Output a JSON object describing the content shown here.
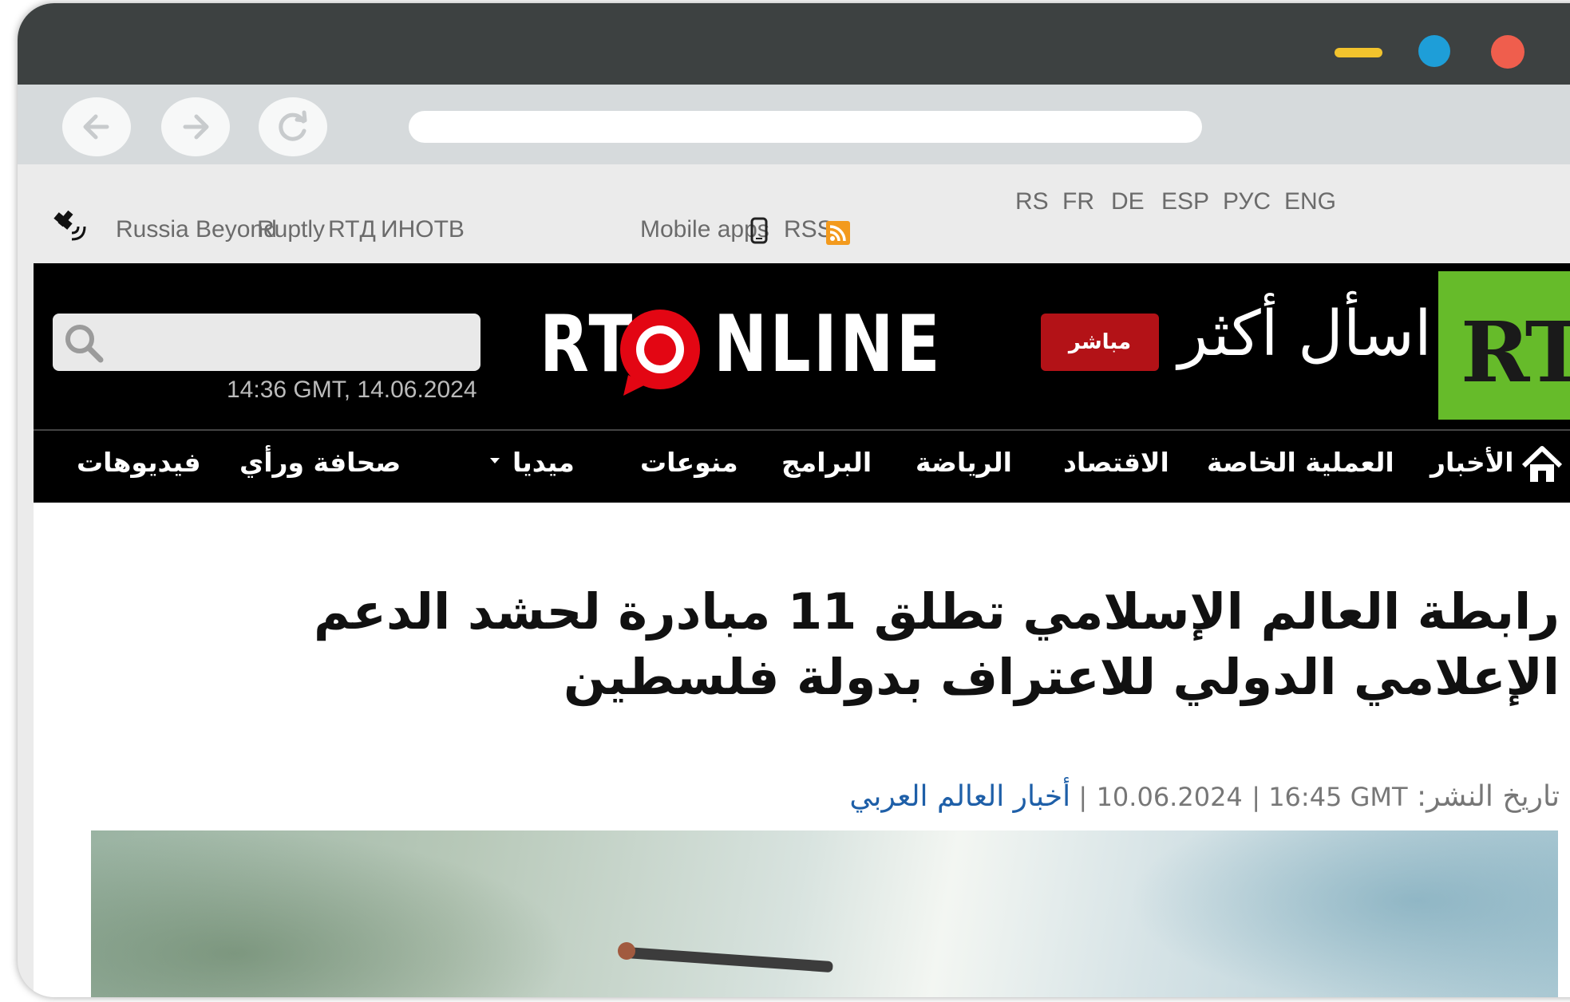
{
  "browser": {
    "back_icon": "arrow-left-icon",
    "forward_icon": "arrow-right-icon",
    "reload_icon": "reload-icon"
  },
  "topbar": {
    "links": [
      "Russia Beyond",
      "Ruptly",
      "RTД",
      "ИНОТВ"
    ],
    "mobile_apps": "Mobile apps",
    "rss": "RSS",
    "languages": [
      "RS",
      "FR",
      "DE",
      "ESP",
      "РУС",
      "ENG"
    ]
  },
  "header": {
    "search_placeholder": "",
    "datetime": "14:36 GMT, 14.06.2024",
    "logo_left": "RT",
    "logo_right": "NLINE",
    "live_label": "مباشر",
    "slogan": "اسأل أكثر",
    "brand": "RT"
  },
  "menu": {
    "items": [
      "الأخبار",
      "العملية الخاصة",
      "الاقتصاد",
      "الرياضة",
      "البرامج",
      "منوعات",
      "ميديا",
      "صحافة ورأي",
      "فيديوهات"
    ]
  },
  "article": {
    "title": "رابطة العالم الإسلامي تطلق 11 مبادرة لحشد الدعم الإعلامي الدولي للاعتراف بدولة فلسطين",
    "date_label": "تاريخ النشر:",
    "date": "10.06.2024",
    "time": "16:45 GMT",
    "category": "أخبار العالم العربي"
  },
  "colors": {
    "live_red": "#b31217",
    "brand_green": "#66bb2a",
    "rss_orange": "#f39a1d",
    "link_blue": "#1e5fa8"
  }
}
